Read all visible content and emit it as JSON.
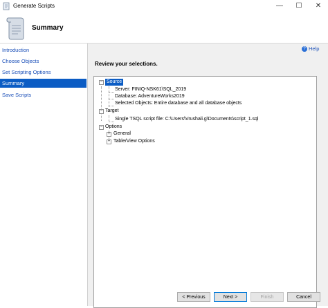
{
  "window": {
    "title": "Generate Scripts",
    "controls": {
      "minimize": "—",
      "maximize": "☐",
      "close": "✕"
    }
  },
  "header": {
    "page_title": "Summary"
  },
  "sidebar": {
    "items": [
      {
        "label": "Introduction",
        "active": false
      },
      {
        "label": "Choose Objects",
        "active": false
      },
      {
        "label": "Set Scripting Options",
        "active": false
      },
      {
        "label": "Summary",
        "active": true
      },
      {
        "label": "Save Scripts",
        "active": false
      }
    ]
  },
  "main": {
    "help_label": "Help",
    "review_label": "Review your selections.",
    "tree": {
      "source": {
        "label": "Source",
        "children": [
          "Server: FINIQ-NSK61\\SQL_2019",
          "Database: AdventureWorks2019",
          "Selected Objects: Entire database and all database objects"
        ]
      },
      "target": {
        "label": "Target",
        "children": [
          "Single TSQL script file: C:\\Users\\Vrushali.g\\Documents\\script_1.sql"
        ]
      },
      "options": {
        "label": "Options",
        "children": [
          "General",
          "Table/View Options"
        ]
      }
    }
  },
  "footer": {
    "previous": "< Previous",
    "next": "Next >",
    "finish": "Finish",
    "cancel": "Cancel"
  }
}
